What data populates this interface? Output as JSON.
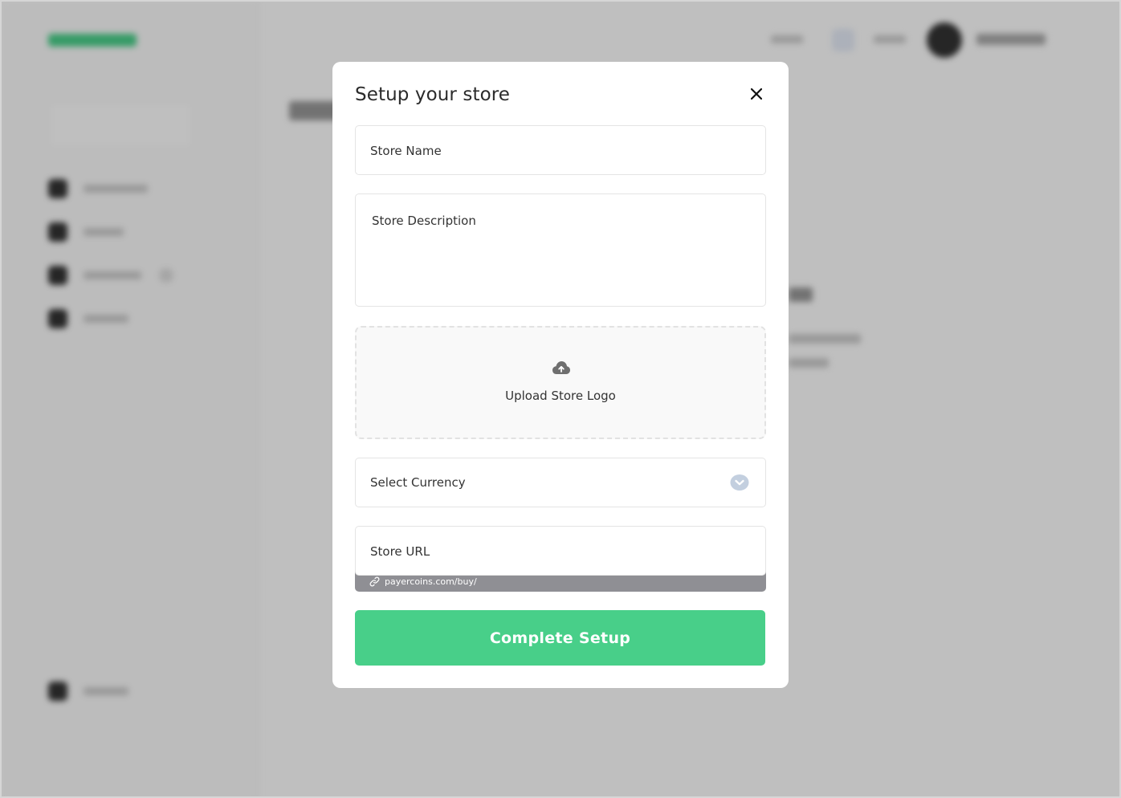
{
  "modal": {
    "title": "Setup your store",
    "store_name_placeholder": "Store Name",
    "store_description_placeholder": "Store Description",
    "upload_label": "Upload Store Logo",
    "currency_label": "Select Currency",
    "store_url_placeholder": "Store URL",
    "url_prefix": "payercoins.com/buy/",
    "submit_label": "Complete Setup"
  },
  "icons": {
    "close": "close-icon",
    "upload": "cloud-upload-icon",
    "currency_toggle": "chevron-down-icon",
    "url": "link-icon"
  },
  "colors": {
    "accent": "#48cf89",
    "url_strip": "#8f8f94",
    "chevron_circle": "#c3cfdf"
  }
}
